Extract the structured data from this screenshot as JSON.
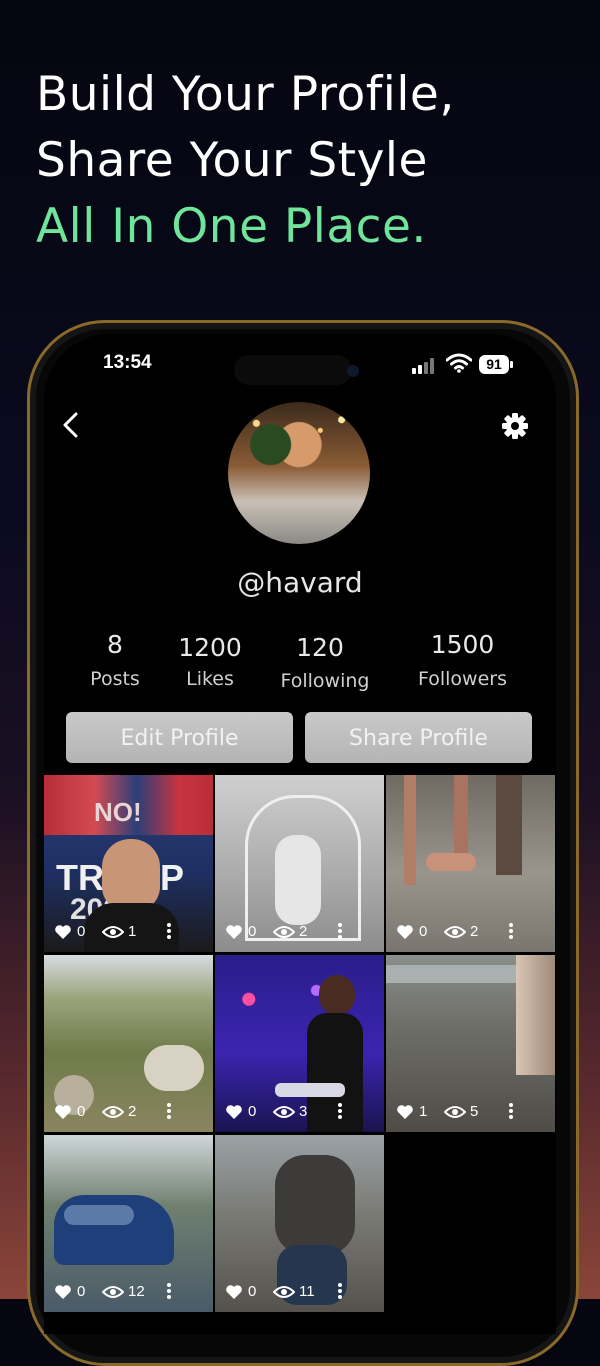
{
  "headline": {
    "line1": "Build Your Profile,",
    "line2": "Share Your Style",
    "line3": "All In One Place."
  },
  "status_bar": {
    "time": "13:54",
    "battery": "91"
  },
  "profile": {
    "username": "@havard",
    "stats": [
      {
        "value": "8",
        "label": "Posts"
      },
      {
        "value": "1200",
        "label": "Likes"
      },
      {
        "value": "120",
        "label": "Following"
      },
      {
        "value": "1500",
        "label": "Followers"
      }
    ],
    "edit_label": "Edit Profile",
    "share_label": "Share Profile"
  },
  "posts": [
    {
      "likes": "0",
      "views": "1"
    },
    {
      "likes": "0",
      "views": "2"
    },
    {
      "likes": "0",
      "views": "2"
    },
    {
      "likes": "0",
      "views": "2"
    },
    {
      "likes": "0",
      "views": "3"
    },
    {
      "likes": "1",
      "views": "5"
    },
    {
      "likes": "0",
      "views": "12"
    },
    {
      "likes": "0",
      "views": "11"
    }
  ],
  "tile_texts": {
    "sign_no": "NO!",
    "sign_trump": "TRUMP",
    "sign_year": "2024"
  },
  "colors": {
    "accent": "#6fe49a",
    "button": "#bdbdbd",
    "frame": "#8a6a2a"
  }
}
